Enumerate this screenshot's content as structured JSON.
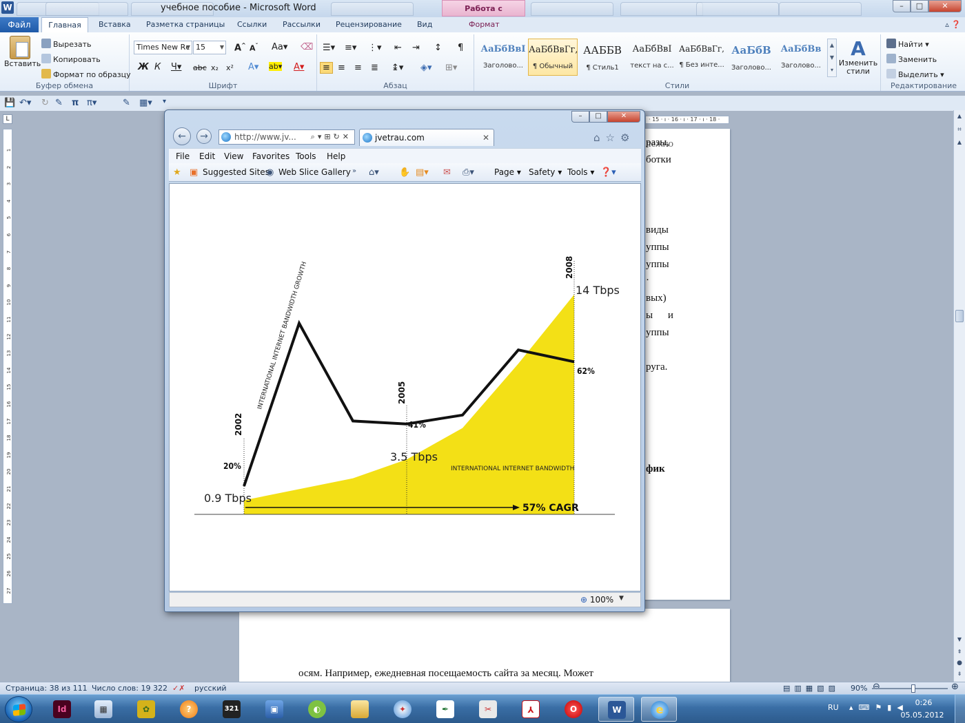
{
  "word": {
    "title": "учебное пособие - Microsoft Word",
    "context_tab": "Работа с рисунками",
    "file_tab": "Файл",
    "tabs": [
      "Главная",
      "Вставка",
      "Разметка страницы",
      "Ссылки",
      "Рассылки",
      "Рецензирование",
      "Вид",
      "Формат"
    ],
    "clipboard": {
      "paste": "Вставить",
      "cut": "Вырезать",
      "copy": "Копировать",
      "format_painter": "Формат по образцу",
      "label": "Буфер обмена"
    },
    "font": {
      "name": "Times New Roman",
      "name_shown": "Times New Rc",
      "size": "15",
      "label": "Шрифт"
    },
    "paragraph": {
      "label": "Абзац"
    },
    "styles": {
      "label": "Стили",
      "items": [
        {
          "sample": "АаБбВвІ",
          "name": "Заголово..."
        },
        {
          "sample": "АаБбВвГг,",
          "name": "¶ Обычный"
        },
        {
          "sample": "ААББВ",
          "name": "¶ Стиль1"
        },
        {
          "sample": "АаБбВвІ",
          "name": "текст на с..."
        },
        {
          "sample": "АаБбВвГг,",
          "name": "¶ Без инте..."
        },
        {
          "sample": "АаБбВ",
          "name": "Заголово..."
        },
        {
          "sample": "АаБбВв",
          "name": "Заголово..."
        }
      ],
      "change_styles": "Изменить стили"
    },
    "editing": {
      "find": "Найти",
      "replace": "Заменить",
      "select": "Выделить",
      "label": "Редактирование"
    },
    "ruler_tail": "· 15 · ı · 16 · ı · 17 · ı · 18 ·",
    "ruler_numbers": [
      "1",
      "2",
      "3",
      "4",
      "5",
      "6",
      "7",
      "8",
      "9",
      "10",
      "11",
      "12",
      "13",
      "14",
      "15",
      "16",
      "17",
      "18",
      "19",
      "20",
      "21",
      "22",
      "23",
      "24",
      "25",
      "26",
      "27"
    ],
    "doc_fragments": [
      "лежно",
      "разы,",
      "ботки",
      "виды",
      "уппы",
      "уппы",
      "·",
      "вых)",
      "ы и",
      "уппы",
      "руга.",
      "фик"
    ],
    "bottom_line": "осям. Например, ежедневная посещаемость сайта за месяц. Может",
    "status": {
      "page": "Страница: 38 из 111",
      "words": "Число слов: 19 322",
      "lang": "русский",
      "zoom": "90%"
    }
  },
  "ie": {
    "address": "http://www.jv...",
    "tab_title": "jvetrau.com",
    "menu": [
      "File",
      "Edit",
      "View",
      "Favorites",
      "Tools",
      "Help"
    ],
    "favorites": {
      "suggested": "Suggested Sites",
      "slice": "Web Slice Gallery"
    },
    "commands": {
      "page": "Page",
      "safety": "Safety",
      "tools": "Tools"
    },
    "zoom": "100%"
  },
  "chart_data": {
    "type": "line",
    "series": [
      {
        "name": "INTERNATIONAL INTERNET BANDWIDTH GROWTH",
        "unit": "%",
        "points": [
          {
            "x": "2002",
            "y": 20
          },
          {
            "x": "2003",
            "y": 75
          },
          {
            "x": "2004",
            "y": 42
          },
          {
            "x": "2005",
            "y": 41
          },
          {
            "x": "2006",
            "y": 44
          },
          {
            "x": "2007",
            "y": 66
          },
          {
            "x": "2008",
            "y": 62
          }
        ]
      },
      {
        "name": "INTERNATIONAL INTERNET BANDWIDTH",
        "type": "area",
        "unit": "Tbps",
        "color": "#f3e016",
        "points": [
          {
            "x": "2002",
            "y": 0.9
          },
          {
            "x": "2004",
            "y": 2.3
          },
          {
            "x": "2005",
            "y": 3.5
          },
          {
            "x": "2006",
            "y": 5.5
          },
          {
            "x": "2007",
            "y": 9.6
          },
          {
            "x": "2008",
            "y": 14
          }
        ]
      }
    ],
    "labels": {
      "year_2002": "2002",
      "year_2005": "2005",
      "year_2008": "2008",
      "pct_start": "20%",
      "pct_mid": "41%",
      "pct_end": "62%",
      "bw_start": "0.9 Tbps",
      "bw_mid": "3.5 Tbps",
      "bw_end": "14 Tbps",
      "cagr": "57% CAGR"
    },
    "line_color": "#111111"
  },
  "taskbar": {
    "lang": "RU",
    "time": "0:26",
    "date": "05.05.2012"
  }
}
